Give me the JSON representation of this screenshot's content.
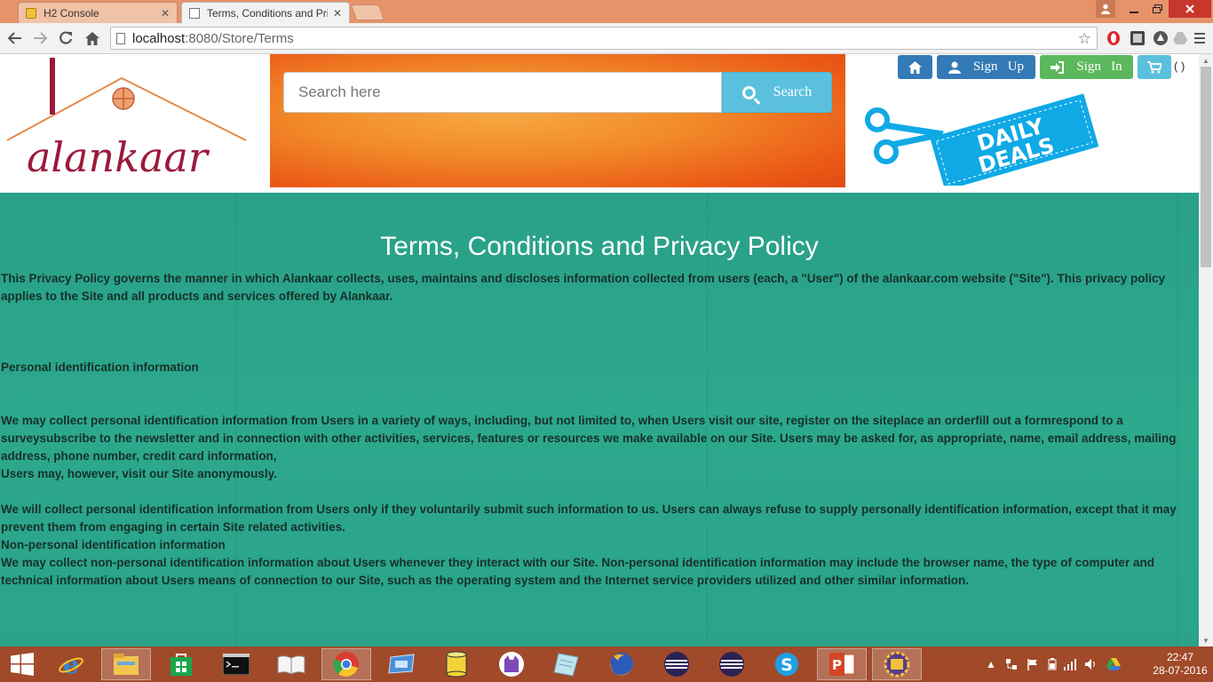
{
  "browser": {
    "tabs": [
      {
        "label": "H2 Console",
        "active": false
      },
      {
        "label": "Terms, Conditions and Pri",
        "active": true
      }
    ],
    "close_glyph": "✕",
    "url_host": "localhost",
    "url_path": ":8080/Store/Terms"
  },
  "header": {
    "logo_text": "alankaar",
    "search_placeholder": "Search here",
    "search_label": "Search",
    "signup_label": "Sign   Up",
    "signin_label": "Sign   In",
    "cart_count": "( )",
    "deals_text_1": "DAILY",
    "deals_text_2": "DEALS"
  },
  "policy": {
    "title": "Terms, Conditions and Privacy Policy",
    "intro": "This Privacy Policy governs the manner in which Alankaar collects, uses, maintains and discloses information collected from users (each, a \"User\") of the alankaar.com website (\"Site\"). This privacy policy applies to the Site and all products and services offered by Alankaar.",
    "section1_heading": "Personal identification information",
    "section1_p1": "We may collect personal identification information from Users in a variety of ways, including, but not limited to, when Users visit our site, register on the siteplace an orderfill out a formrespond to a surveysubscribe to the newsletter and in connection with other activities, services, features or resources we make available on our Site. Users may be asked for, as appropriate, name, email address, mailing address, phone number, credit card information,",
    "section1_p2": "Users may, however, visit our Site anonymously.",
    "section1_p3": "We will collect personal identification information from Users only if they voluntarily submit such information to us. Users can always refuse to supply personally identification information, except that it may prevent them from engaging in certain Site related activities.",
    "section2_heading": "Non-personal identification information",
    "section2_p1": "We may collect non-personal identification information about Users whenever they interact with our Site. Non-personal identification information may include the browser name, the type of computer and technical information about Users means of connection to our Site, such as the operating system and the Internet service providers utilized and other similar information."
  },
  "taskbar": {
    "time": "22:47",
    "date": "28-07-2016"
  },
  "colors": {
    "page_bg": "#2aa188",
    "brand": "#9b1a3c",
    "primary": "#337ab7",
    "success": "#5cb85c",
    "info": "#5bc0de"
  }
}
